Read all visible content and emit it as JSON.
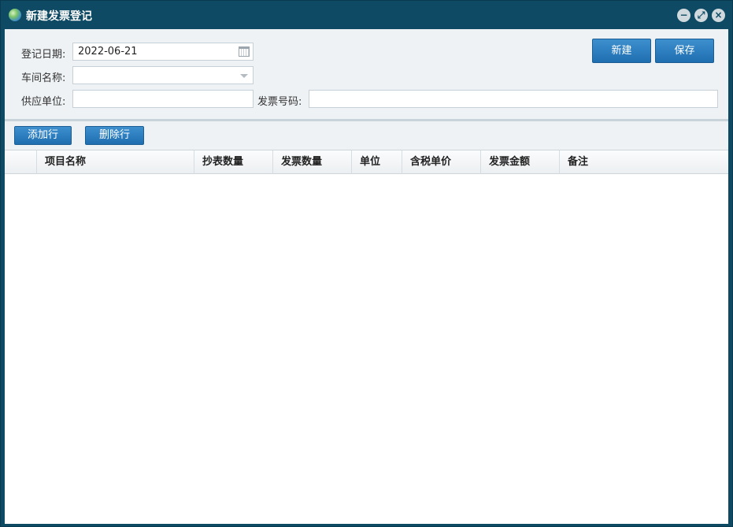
{
  "window": {
    "title": "新建发票登记",
    "icon": "globe-icon"
  },
  "form": {
    "date_label": "登记日期:",
    "date_value": "2022-06-21",
    "workshop_label": "车间名称:",
    "workshop_value": "",
    "supplier_label": "供应单位:",
    "supplier_value": "",
    "invoice_no_label": "发票号码:",
    "invoice_no_value": ""
  },
  "actions": {
    "new_label": "新建",
    "save_label": "保存"
  },
  "toolbar": {
    "add_row_label": "添加行",
    "delete_row_label": "删除行"
  },
  "table": {
    "columns": [
      "项目名称",
      "抄表数量",
      "发票数量",
      "单位",
      "含税单价",
      "发票金额",
      "备注"
    ],
    "rows": []
  },
  "colors": {
    "titlebar": "#0e4a63",
    "button": "#2a7cbf",
    "panel": "#eef2f5"
  }
}
